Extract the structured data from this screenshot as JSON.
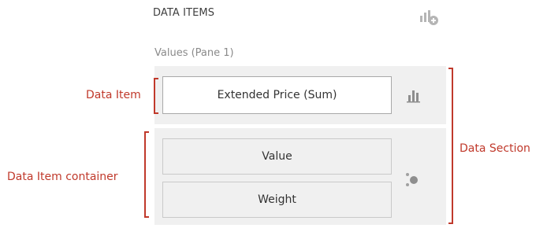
{
  "header": {
    "title": "DATA ITEMS",
    "add_icon": "add-data-item-icon"
  },
  "pane": {
    "label": "Values (Pane 1)"
  },
  "items": {
    "primary": {
      "label": "Extended Price (Sum)",
      "icon": "bar-chart-icon"
    },
    "container": [
      {
        "label": "Value"
      },
      {
        "label": "Weight"
      }
    ],
    "container_icon": "bubble-icon"
  },
  "annotations": {
    "data_item": "Data Item",
    "data_item_container": "Data Item container",
    "data_section": "Data Section"
  },
  "colors": {
    "annotation": "#c0392b",
    "panel": "#f0f0f0",
    "icon": "#9a9a9a"
  }
}
